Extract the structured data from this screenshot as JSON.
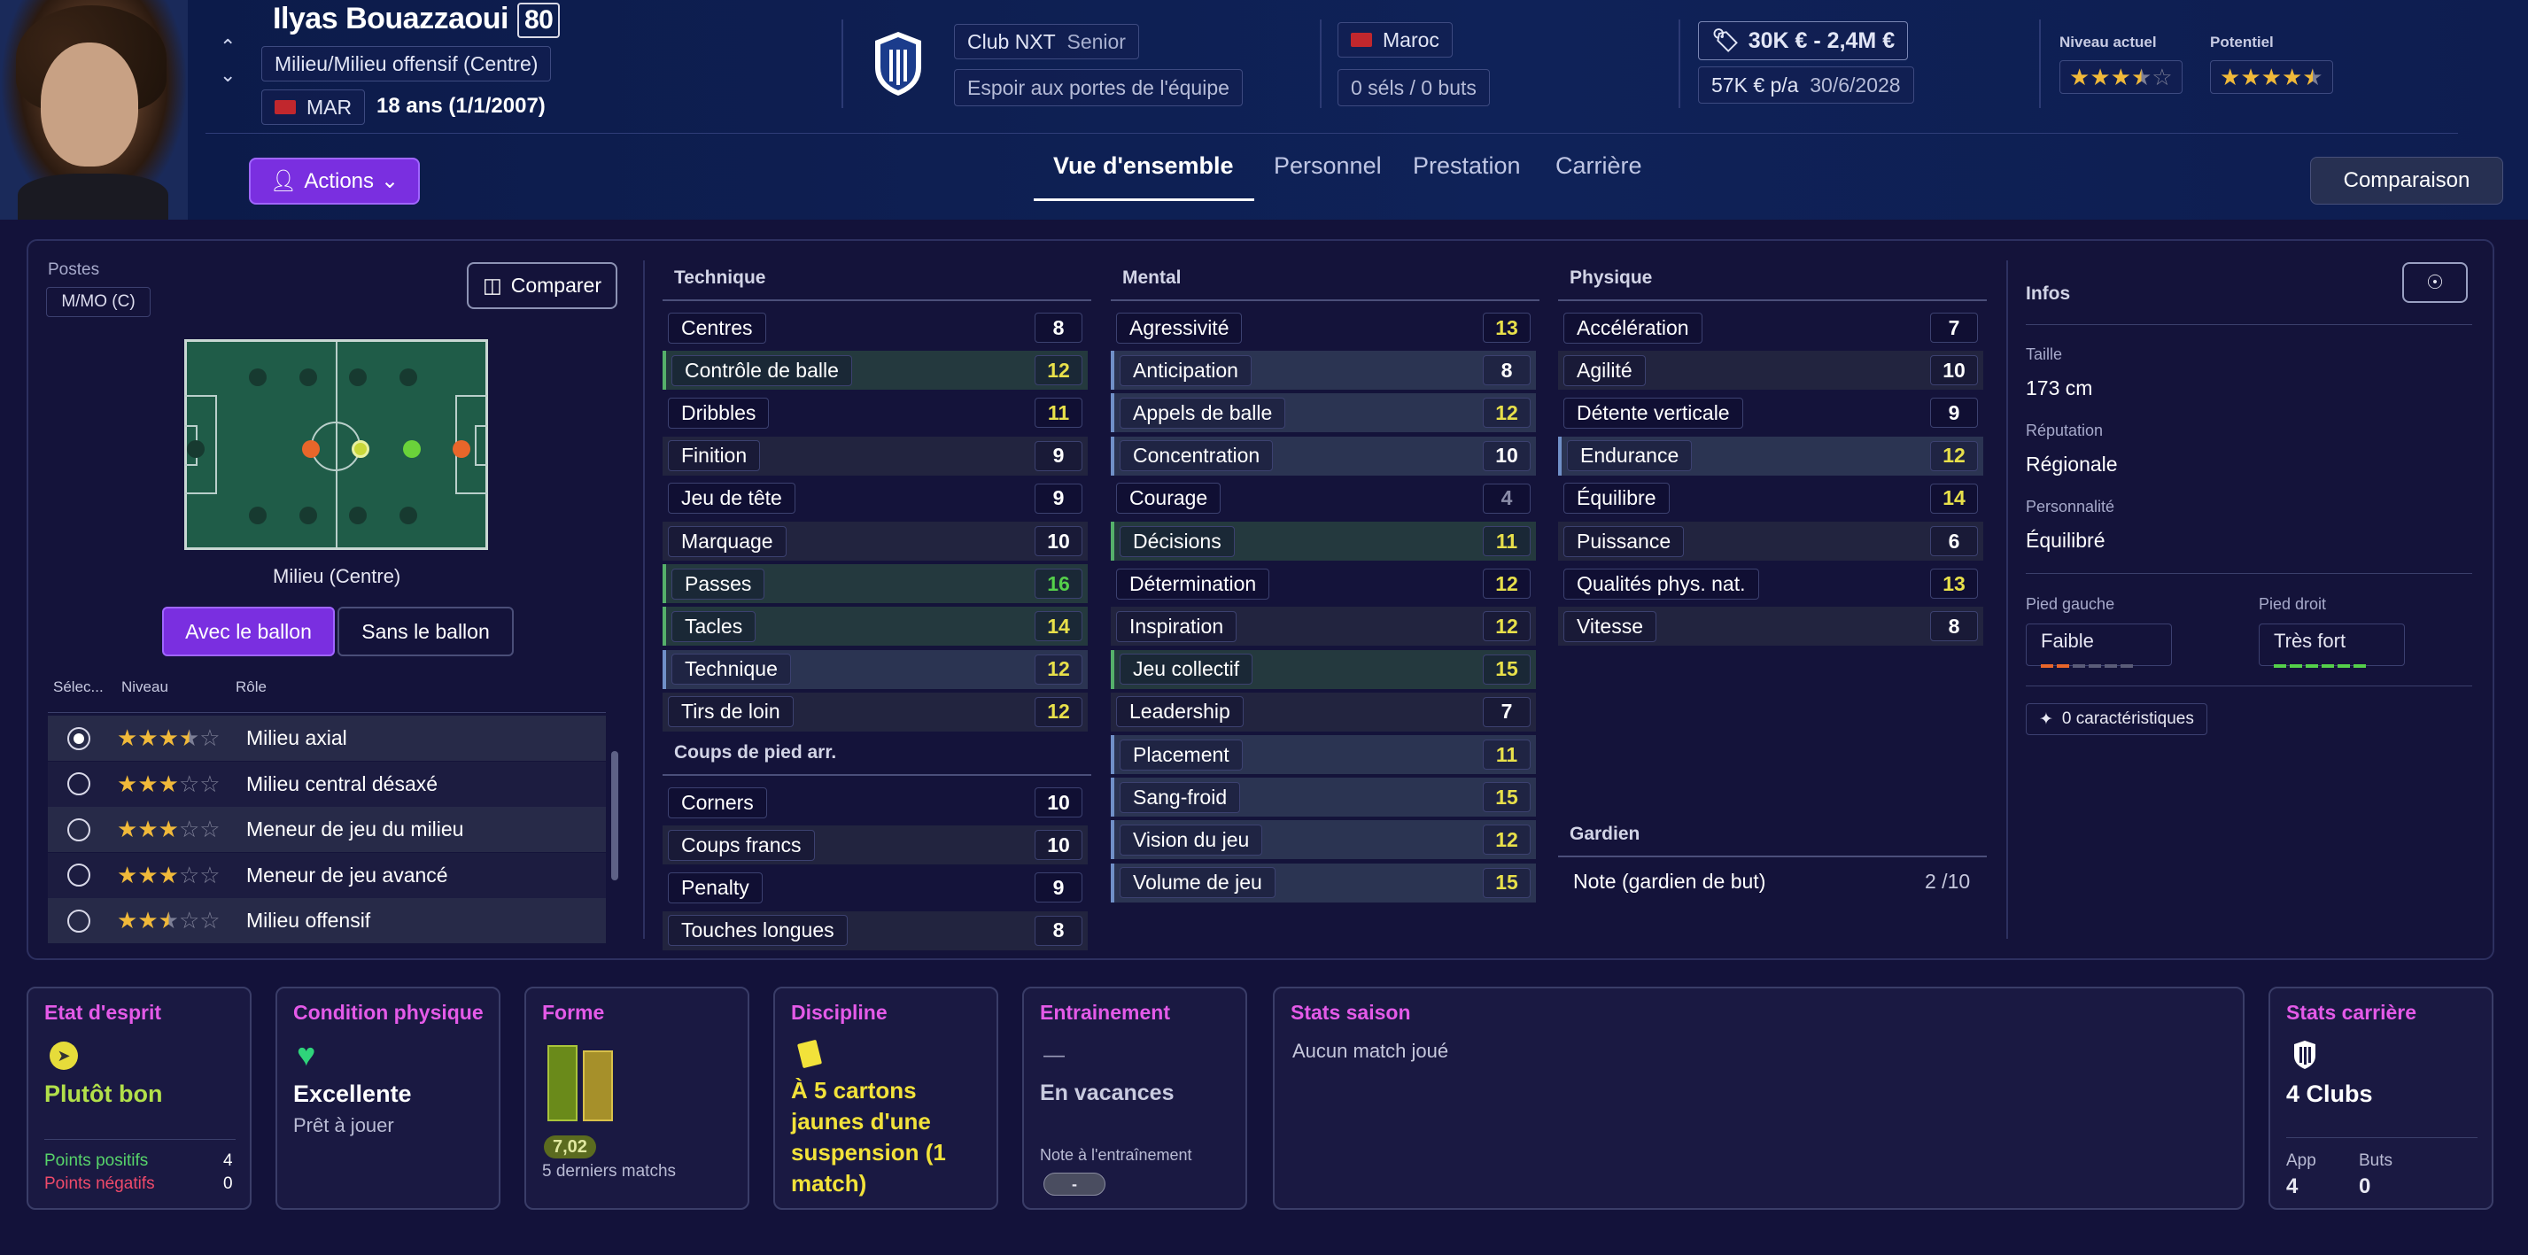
{
  "player": {
    "name": "Ilyas Bouazzaoui",
    "ca": "80",
    "positions_text": "Milieu/Milieu offensif (Centre)",
    "nation_code": "MAR",
    "age": "18 ans (1/1/2007)"
  },
  "club": {
    "name": "Club NXT",
    "squad": "Senior",
    "status": "Espoir aux portes de l'équipe"
  },
  "intl": {
    "nation": "Maroc",
    "caps": "0 séls / 0 buts"
  },
  "contract": {
    "value": "30K € - 2,4M €",
    "wage": "57K € p/a",
    "expiry": "30/6/2028"
  },
  "ratings": {
    "current_label": "Niveau actuel",
    "potential_label": "Potentiel",
    "current_stars": 3.5,
    "potential_stars": 4.5
  },
  "actions_label": "Actions",
  "tabs": [
    {
      "label": "Vue d'ensemble",
      "active": true
    },
    {
      "label": "Personnel"
    },
    {
      "label": "Prestation"
    },
    {
      "label": "Carrière"
    }
  ],
  "compare_label": "Comparaison",
  "positions_panel": {
    "title": "Postes",
    "badge": "M/MO (C)",
    "compare_btn": "Comparer",
    "position_name": "Milieu (Centre)",
    "with_ball": "Avec le ballon",
    "without_ball": "Sans le ballon",
    "col_select": "Sélec...",
    "col_level": "Niveau",
    "col_role": "Rôle",
    "roles": [
      {
        "name": "Milieu axial",
        "stars": 3.5,
        "selected": true
      },
      {
        "name": "Milieu central désaxé",
        "stars": 3
      },
      {
        "name": "Meneur de jeu du milieu",
        "stars": 3
      },
      {
        "name": "Meneur de jeu avancé",
        "stars": 3
      },
      {
        "name": "Milieu offensif",
        "stars": 2.5
      }
    ]
  },
  "technique": {
    "title": "Technique",
    "attrs": [
      {
        "name": "Centres",
        "value": 8
      },
      {
        "name": "Contrôle de balle",
        "value": 12,
        "hl": "hg"
      },
      {
        "name": "Dribbles",
        "value": 11
      },
      {
        "name": "Finition",
        "value": 9
      },
      {
        "name": "Jeu de tête",
        "value": 9
      },
      {
        "name": "Marquage",
        "value": 10
      },
      {
        "name": "Passes",
        "value": 16,
        "hl": "hg"
      },
      {
        "name": "Tacles",
        "value": 14,
        "hl": "hg"
      },
      {
        "name": "Technique",
        "value": 12,
        "hl": "hb"
      },
      {
        "name": "Tirs de loin",
        "value": 12
      }
    ]
  },
  "setpieces": {
    "title": "Coups de pied arr.",
    "attrs": [
      {
        "name": "Corners",
        "value": 10
      },
      {
        "name": "Coups francs",
        "value": 10
      },
      {
        "name": "Penalty",
        "value": 9
      },
      {
        "name": "Touches longues",
        "value": 8
      }
    ]
  },
  "mental": {
    "title": "Mental",
    "attrs": [
      {
        "name": "Agressivité",
        "value": 13
      },
      {
        "name": "Anticipation",
        "value": 8,
        "hl": "hb"
      },
      {
        "name": "Appels de balle",
        "value": 12,
        "hl": "hb"
      },
      {
        "name": "Concentration",
        "value": 10,
        "hl": "hb"
      },
      {
        "name": "Courage",
        "value": 4
      },
      {
        "name": "Décisions",
        "value": 11,
        "hl": "hg"
      },
      {
        "name": "Détermination",
        "value": 12
      },
      {
        "name": "Inspiration",
        "value": 12
      },
      {
        "name": "Jeu collectif",
        "value": 15,
        "hl": "hg"
      },
      {
        "name": "Leadership",
        "value": 7
      },
      {
        "name": "Placement",
        "value": 11,
        "hl": "hb"
      },
      {
        "name": "Sang-froid",
        "value": 15,
        "hl": "hb"
      },
      {
        "name": "Vision du jeu",
        "value": 12,
        "hl": "hb"
      },
      {
        "name": "Volume de jeu",
        "value": 15,
        "hl": "hb"
      }
    ]
  },
  "physique": {
    "title": "Physique",
    "attrs": [
      {
        "name": "Accélération",
        "value": 7
      },
      {
        "name": "Agilité",
        "value": 10
      },
      {
        "name": "Détente verticale",
        "value": 9
      },
      {
        "name": "Endurance",
        "value": 12,
        "hl": "hb"
      },
      {
        "name": "Équilibre",
        "value": 14
      },
      {
        "name": "Puissance",
        "value": 6
      },
      {
        "name": "Qualités phys. nat.",
        "value": 13
      },
      {
        "name": "Vitesse",
        "value": 8
      }
    ]
  },
  "goalkeeper": {
    "title": "Gardien",
    "label": "Note (gardien de but)",
    "value": "2 /10"
  },
  "infos": {
    "title": "Infos",
    "height_label": "Taille",
    "height": "173 cm",
    "reputation_label": "Réputation",
    "reputation": "Régionale",
    "personality_label": "Personnalité",
    "personality": "Équilibré",
    "left_foot_label": "Pied gauche",
    "left_foot": "Faible",
    "left_foot_level": 2,
    "right_foot_label": "Pied droit",
    "right_foot": "Très fort",
    "right_foot_level": 6,
    "traits": "0 caractéristiques"
  },
  "cards": {
    "morale": {
      "title": "Etat d'esprit",
      "value": "Plutôt bon",
      "pos_label": "Points positifs",
      "pos": "4",
      "neg_label": "Points négatifs",
      "neg": "0"
    },
    "condition": {
      "title": "Condition physique",
      "value": "Excellente",
      "sub": "Prêt à jouer"
    },
    "form": {
      "title": "Forme",
      "rating": "7,02",
      "sub": "5 derniers matchs"
    },
    "discipline": {
      "title": "Discipline",
      "value": "À 5 cartons jaunes d'une suspension (1 match)"
    },
    "training": {
      "title": "Entrainement",
      "dash": "—",
      "value": "En vacances",
      "note_label": "Note à l'entraînement",
      "note": "-"
    },
    "season": {
      "title": "Stats saison",
      "value": "Aucun match joué"
    },
    "career": {
      "title": "Stats carrière",
      "value": "4 Clubs",
      "apps_label": "App",
      "apps": "4",
      "goals_label": "Buts",
      "goals": "0"
    }
  },
  "colors": {
    "accent": "#7a2fe0",
    "good": "#55d04a",
    "yellow": "#e8e04a",
    "pink": "#e45ae8"
  }
}
